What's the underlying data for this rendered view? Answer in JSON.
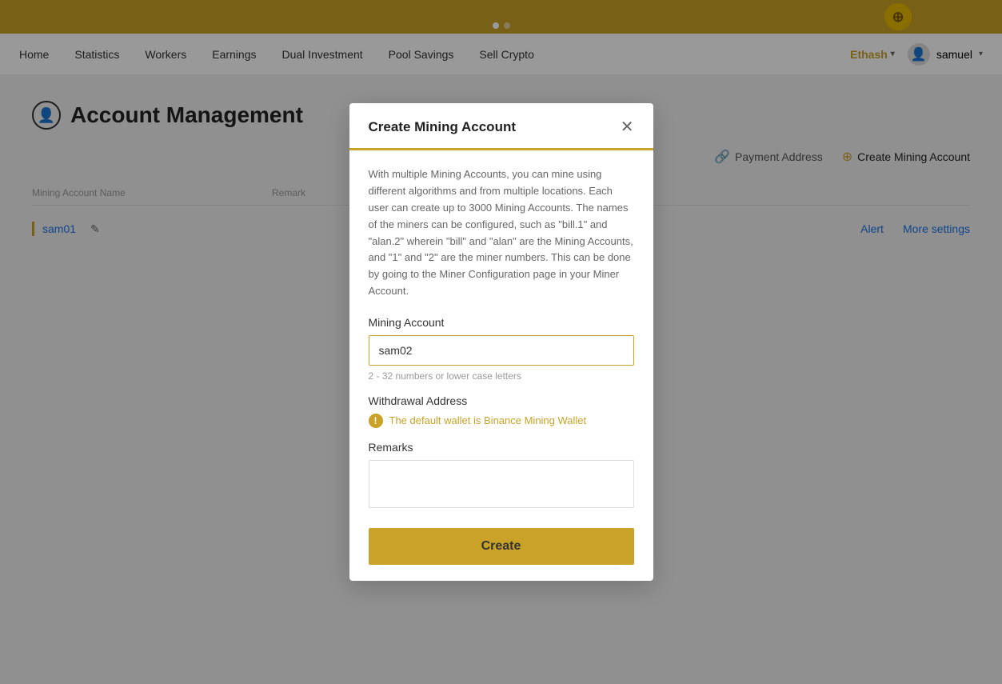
{
  "banner": {
    "dots": [
      {
        "active": true
      },
      {
        "active": false
      }
    ]
  },
  "nav": {
    "items": [
      {
        "label": "Home",
        "id": "home"
      },
      {
        "label": "Statistics",
        "id": "statistics"
      },
      {
        "label": "Workers",
        "id": "workers"
      },
      {
        "label": "Earnings",
        "id": "earnings"
      },
      {
        "label": "Dual Investment",
        "id": "dual-investment"
      },
      {
        "label": "Pool Savings",
        "id": "pool-savings"
      },
      {
        "label": "Sell Crypto",
        "id": "sell-crypto"
      }
    ],
    "ethash_label": "Ethash",
    "user_label": "samuel"
  },
  "page": {
    "title": "Account Management",
    "actions": {
      "payment_address": "Payment Address",
      "create_mining_account": "Create Mining Account"
    },
    "table": {
      "headers": {
        "name": "Mining Account Name",
        "remark": "Remark"
      },
      "rows": [
        {
          "name": "sam01",
          "alert": "Alert",
          "more_settings": "More settings"
        }
      ]
    }
  },
  "modal": {
    "title": "Create Mining Account",
    "info": "With multiple Mining Accounts, you can mine using different algorithms and from multiple locations. Each user can create up to 3000 Mining Accounts. The names of the miners can be configured, such as \"bill.1\" and \"alan.2\" wherein \"bill\" and \"alan\" are the Mining Accounts, and \"1\" and \"2\" are the miner numbers. This can be done by going to the Miner Configuration page in your Miner Account.",
    "mining_account_label": "Mining Account",
    "mining_account_value": "sam02",
    "mining_account_hint": "2 - 32 numbers or lower case letters",
    "withdrawal_address_label": "Withdrawal Address",
    "withdrawal_warning": "The default wallet is Binance Mining Wallet",
    "remarks_label": "Remarks",
    "create_button": "Create"
  }
}
